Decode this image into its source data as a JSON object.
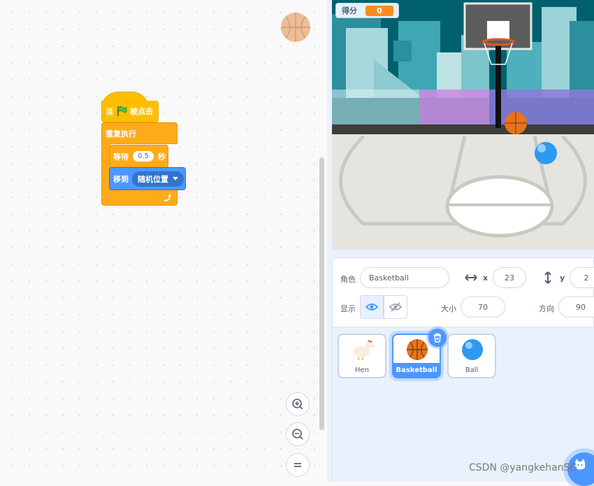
{
  "blocks": {
    "hat": {
      "when": "当",
      "clicked": "被点击"
    },
    "forever": "重复执行",
    "wait": {
      "label": "等待",
      "value": "0.5",
      "unit": "秒"
    },
    "goto": {
      "label": "移到",
      "target": "随机位置"
    }
  },
  "stage": {
    "score_label": "得分",
    "score_value": "0"
  },
  "sprite_info": {
    "sprite_label": "角色",
    "sprite_name": "Basketball",
    "x_label": "x",
    "x_value": "23",
    "y_label": "y",
    "y_value": "2",
    "show_label": "显示",
    "size_label": "大小",
    "size_value": "70",
    "direction_label": "方向",
    "direction_value": "90"
  },
  "sprites": [
    {
      "name": "Hen"
    },
    {
      "name": "Basketball"
    },
    {
      "name": "Ball"
    }
  ],
  "watermark": "CSDN @yangkehanSG",
  "colors": {
    "events": "#ffbf00",
    "control": "#ffab19",
    "motion": "#4c97ff",
    "score": "#ff8c1a",
    "basketball": "#e8731a"
  }
}
